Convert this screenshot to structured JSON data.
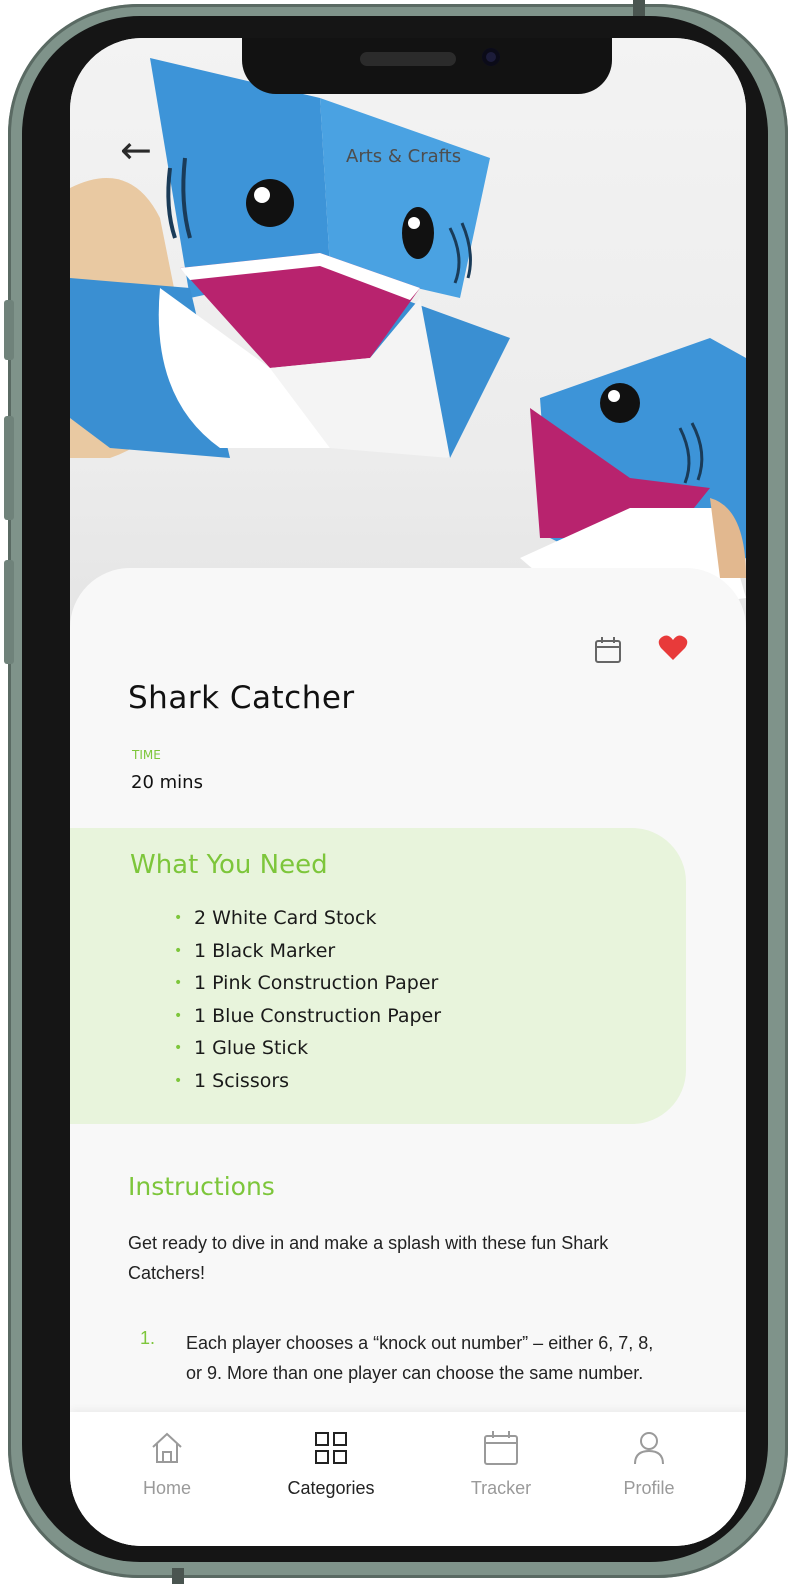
{
  "header": {
    "category": "Arts & Crafts"
  },
  "activity": {
    "title": "Shark Catcher",
    "time_label": "TIME",
    "time_value": "20 mins"
  },
  "what_you_need": {
    "title": "What You Need",
    "items": [
      "2 White Card Stock",
      "1 Black Marker",
      "1 Pink Construction Paper",
      "1 Blue Construction Paper",
      "1 Glue Stick",
      "1 Scissors"
    ]
  },
  "instructions": {
    "title": "Instructions",
    "intro": "Get ready to dive in and make a splash with these fun Shark Catchers!",
    "steps": [
      {
        "number": "1.",
        "text": "Each player chooses a “knock out number” – either 6, 7, 8, or 9. More than one player can choose the same number."
      }
    ]
  },
  "tabbar": {
    "items": [
      {
        "label": "Home",
        "icon": "home-icon",
        "active": false
      },
      {
        "label": "Categories",
        "icon": "grid-icon",
        "active": true
      },
      {
        "label": "Tracker",
        "icon": "calendar-icon",
        "active": false
      },
      {
        "label": "Profile",
        "icon": "person-icon",
        "active": false
      }
    ]
  },
  "colors": {
    "accent_green": "#7dc63b",
    "need_bg": "#e8f4dc",
    "heart_red": "#e83a3a",
    "shark_blue": "#3d94d8",
    "shark_mouth": "#b8236e",
    "frame": "#7f938a"
  }
}
